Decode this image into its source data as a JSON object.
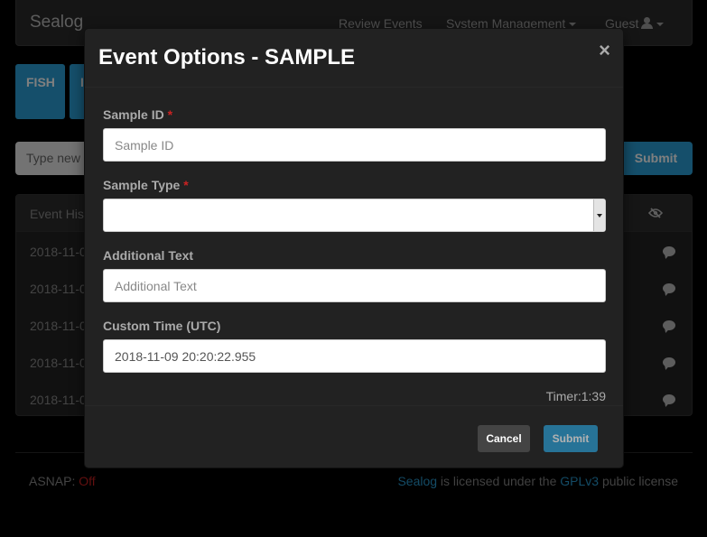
{
  "navbar": {
    "brand": "Sealog",
    "links": [
      "Review Events",
      "System Management",
      "Guest"
    ]
  },
  "event_buttons": [
    "FISH",
    "I"
  ],
  "bg_form": {
    "input_placeholder": "Type new",
    "submit_label": "Submit"
  },
  "history": {
    "title": "Event Hist",
    "rows": [
      "2018-11-0",
      "2018-11-0",
      "2018-11-0",
      "2018-11-0",
      "2018-11-0"
    ]
  },
  "footer": {
    "asnap_label": "ASNAP:",
    "asnap_value": "Off",
    "license_pre": "Sealog",
    "license_mid": " is licensed under the ",
    "license_link": "GPLv3",
    "license_post": " public license"
  },
  "modal": {
    "title": "Event Options - SAMPLE",
    "close": "×",
    "fields": {
      "sample_id": {
        "label": "Sample ID",
        "required": "*",
        "placeholder": "Sample ID",
        "value": ""
      },
      "sample_type": {
        "label": "Sample Type",
        "required": "*",
        "value": ""
      },
      "additional_text": {
        "label": "Additional Text",
        "placeholder": "Additional Text",
        "value": ""
      },
      "custom_time": {
        "label": "Custom Time (UTC)",
        "value": "2018-11-09 20:20:22.955"
      }
    },
    "timer": "Timer:1:39",
    "cancel_label": "Cancel",
    "submit_label": "Submit"
  },
  "colors": {
    "accent": "#2a9fd6",
    "required": "#cc2222"
  }
}
